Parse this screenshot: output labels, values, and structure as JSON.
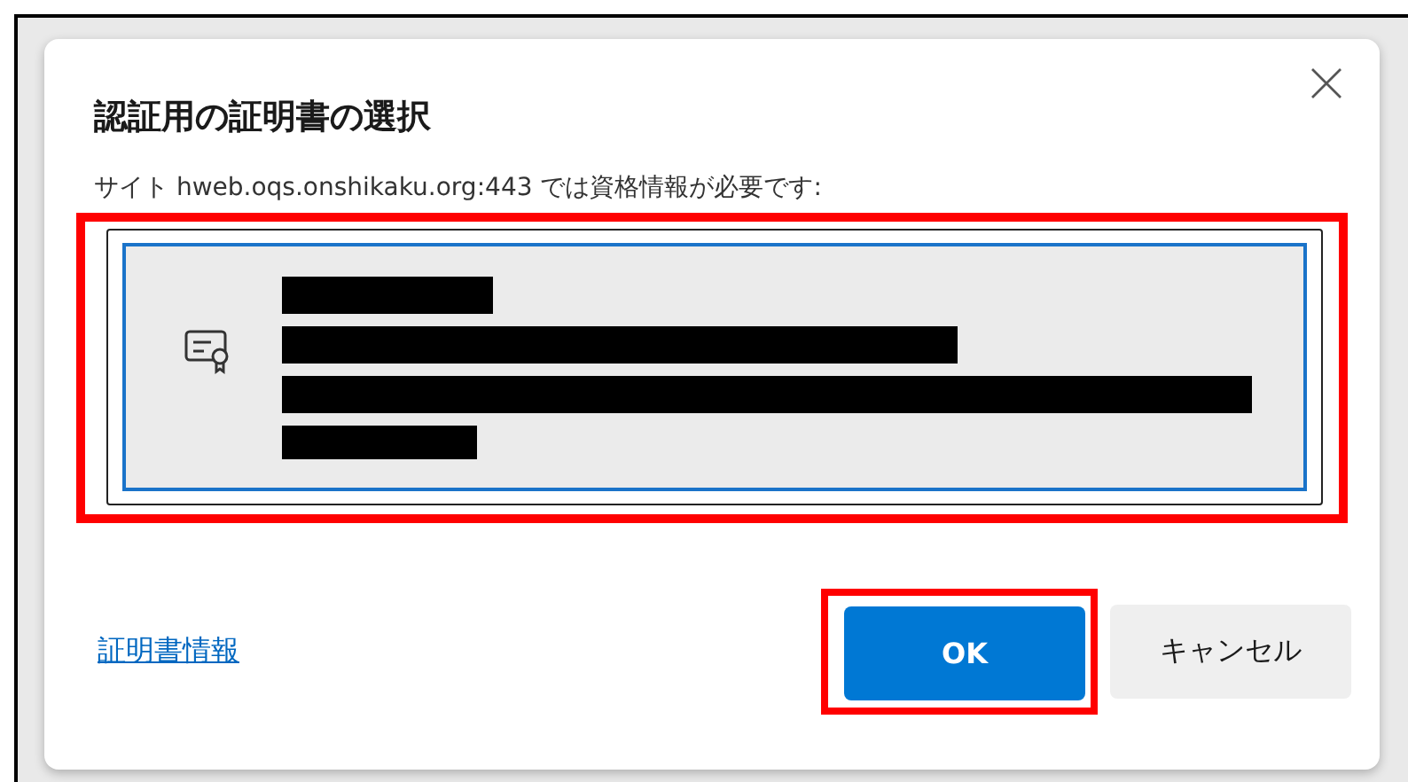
{
  "dialog": {
    "title": "認証用の証明書の選択",
    "message": "サイト hweb.oqs.onshikaku.org:443 では資格情報が必要です:",
    "certificates": [
      {
        "selected": true
      }
    ],
    "link": "証明書情報",
    "buttons": [
      {
        "label": "OK",
        "kind": "primary"
      },
      {
        "label": "キャンセル",
        "kind": "secondary"
      }
    ]
  }
}
